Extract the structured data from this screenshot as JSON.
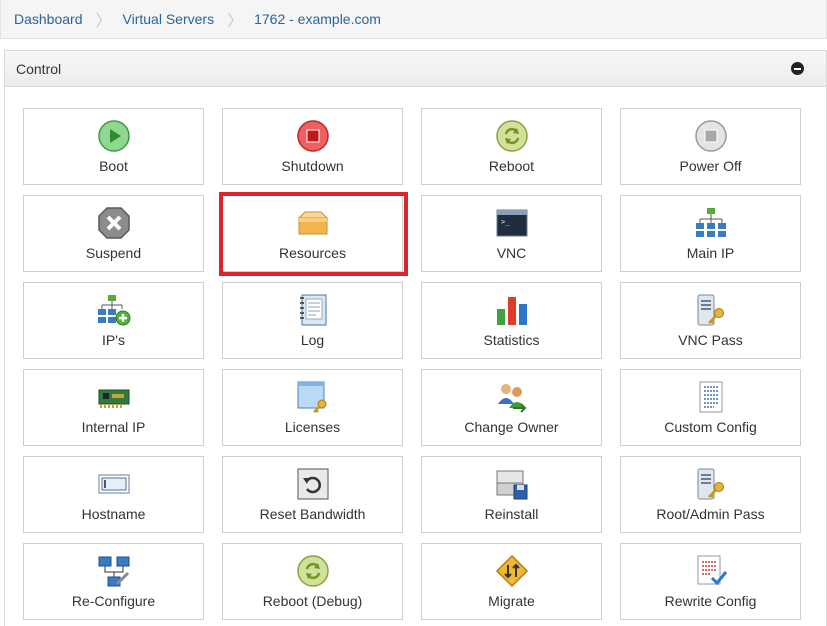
{
  "breadcrumb": {
    "items": [
      "Dashboard",
      "Virtual Servers",
      "1762 - example.com"
    ],
    "separator": "〉"
  },
  "panel": {
    "title": "Control"
  },
  "tiles": [
    {
      "label": "Boot",
      "icon": "boot-icon"
    },
    {
      "label": "Shutdown",
      "icon": "shutdown-icon"
    },
    {
      "label": "Reboot",
      "icon": "reboot-icon"
    },
    {
      "label": "Power Off",
      "icon": "power-off-icon"
    },
    {
      "label": "Suspend",
      "icon": "suspend-icon"
    },
    {
      "label": "Resources",
      "icon": "resources-icon"
    },
    {
      "label": "VNC",
      "icon": "vnc-icon"
    },
    {
      "label": "Main IP",
      "icon": "main-ip-icon"
    },
    {
      "label": "IP's",
      "icon": "ips-icon"
    },
    {
      "label": "Log",
      "icon": "log-icon"
    },
    {
      "label": "Statistics",
      "icon": "statistics-icon"
    },
    {
      "label": "VNC Pass",
      "icon": "vnc-pass-icon"
    },
    {
      "label": "Internal IP",
      "icon": "internal-ip-icon"
    },
    {
      "label": "Licenses",
      "icon": "licenses-icon"
    },
    {
      "label": "Change Owner",
      "icon": "change-owner-icon"
    },
    {
      "label": "Custom Config",
      "icon": "custom-config-icon"
    },
    {
      "label": "Hostname",
      "icon": "hostname-icon"
    },
    {
      "label": "Reset Bandwidth",
      "icon": "reset-bandwidth-icon"
    },
    {
      "label": "Reinstall",
      "icon": "reinstall-icon"
    },
    {
      "label": "Root/Admin Pass",
      "icon": "root-admin-pass-icon"
    },
    {
      "label": "Re-Configure",
      "icon": "re-configure-icon"
    },
    {
      "label": "Reboot (Debug)",
      "icon": "reboot-debug-icon"
    },
    {
      "label": "Migrate",
      "icon": "migrate-icon"
    },
    {
      "label": "Rewrite Config",
      "icon": "rewrite-config-icon"
    }
  ],
  "highlighted_tile": "Resources",
  "colors": {
    "link": "#2a6496",
    "highlight": "#d9252b"
  }
}
